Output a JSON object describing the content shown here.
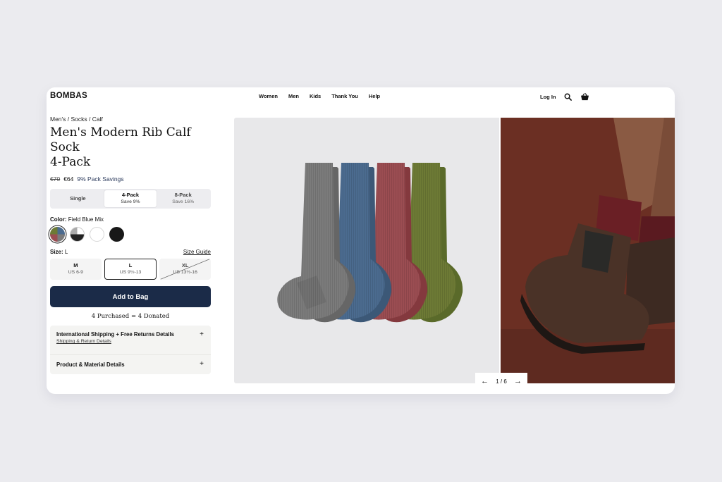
{
  "brand": {
    "logo": "BOMBAS"
  },
  "nav": {
    "links": [
      "Women",
      "Men",
      "Kids",
      "Thank You",
      "Help"
    ],
    "login": "Log In"
  },
  "product": {
    "breadcrumb": "Men's / Socks / Calf",
    "title_line1": "Men's Modern Rib Calf Sock",
    "title_line2": "4-Pack",
    "price_old": "€70",
    "price_new": "€64",
    "savings": "9% Pack Savings"
  },
  "pack_options": [
    {
      "label": "Single",
      "sub": ""
    },
    {
      "label": "4-Pack",
      "sub": "Save 9%"
    },
    {
      "label": "8-Pack",
      "sub": "Save 16%"
    }
  ],
  "selected_pack": "4-Pack",
  "color": {
    "label": "Color:",
    "value": "Field Blue Mix"
  },
  "size": {
    "label": "Size:",
    "value": "L",
    "guide": "Size Guide",
    "options": [
      {
        "label": "M",
        "sub": "US 6-9"
      },
      {
        "label": "L",
        "sub": "US 9½-13"
      },
      {
        "label": "XL",
        "sub": "US 13½-16"
      }
    ]
  },
  "cta": {
    "add_to_bag": "Add to Bag",
    "donation": "4 Purchased = 4 Donated"
  },
  "accordion": {
    "shipping_title": "International Shipping + Free Returns Details",
    "shipping_link": "Shipping & Return Details",
    "material_title": "Product & Material Details",
    "plus": "+"
  },
  "gallery": {
    "pager": "1 / 6",
    "prev": "←",
    "next": "→"
  },
  "colors": {
    "navy": "#1b2b48",
    "sock_grey": "#7b7b7b",
    "sock_blue": "#4b6b8f",
    "sock_red": "#9b4d52",
    "sock_olive": "#6d7a35",
    "backdrop_rust": "#6b2f23"
  }
}
